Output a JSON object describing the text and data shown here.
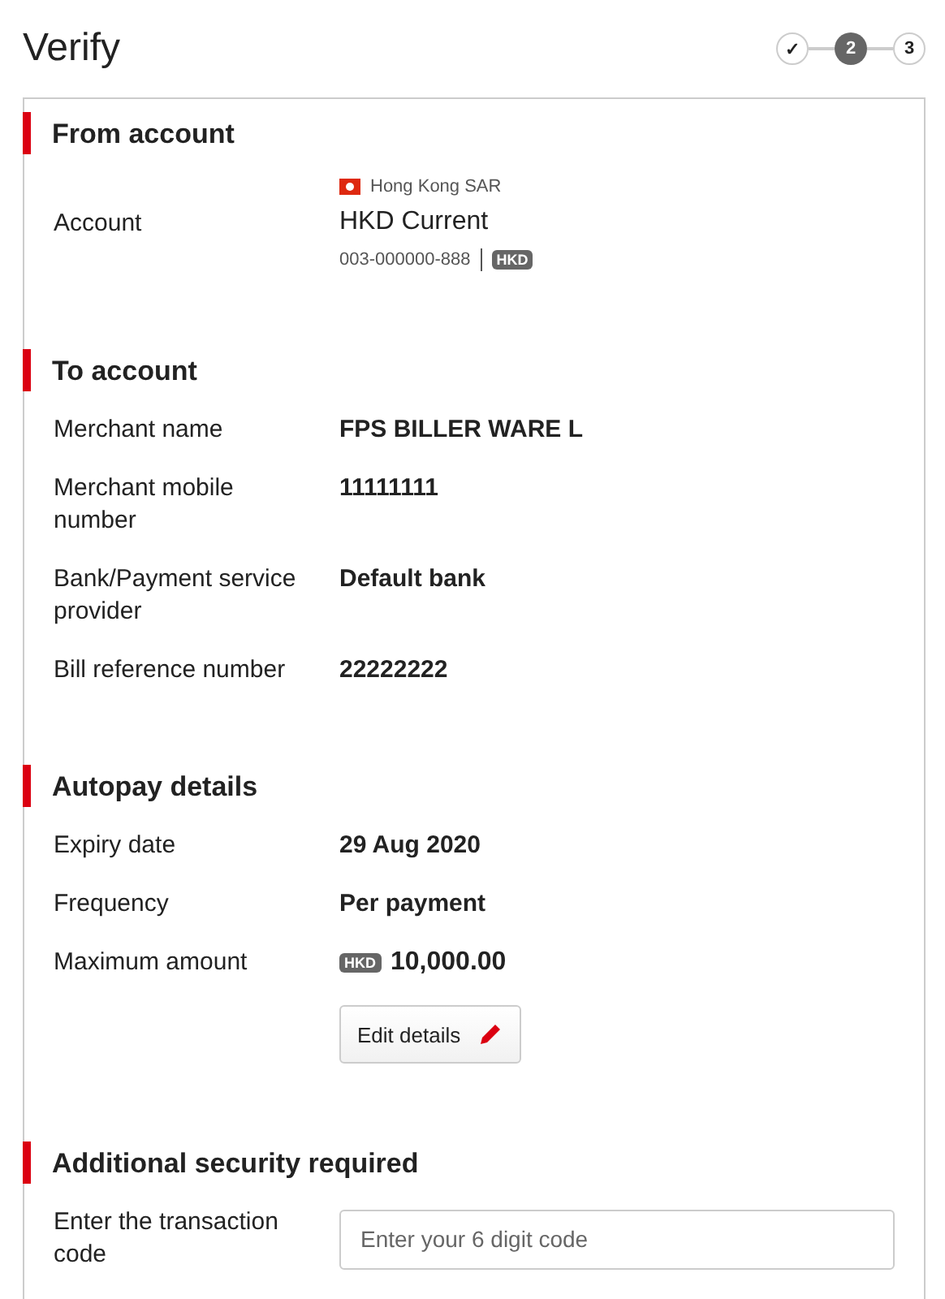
{
  "title": "Verify",
  "steps": [
    {
      "label": "✓",
      "selected": false
    },
    {
      "label": "2",
      "selected": true
    },
    {
      "label": "3",
      "selected": false
    }
  ],
  "sections": [
    {
      "title": "From account",
      "rows": [
        {
          "kind": "account",
          "label": "Account",
          "region": "Hong Kong SAR",
          "name": "HKD Current",
          "number": "003-000000-888",
          "currency": "HKD"
        }
      ]
    },
    {
      "title": "To account",
      "rows": [
        {
          "kind": "text",
          "label": "Merchant name",
          "value": "FPS BILLER WARE L"
        },
        {
          "kind": "text",
          "label": "Merchant mobile number",
          "value": "11111111"
        },
        {
          "kind": "text",
          "label": "Bank/Payment service provider",
          "value": "Default bank"
        },
        {
          "kind": "text",
          "label": "Bill reference number",
          "value": "22222222"
        }
      ]
    },
    {
      "title": "Autopay details",
      "rows": [
        {
          "kind": "text",
          "label": "Expiry date",
          "value": "29 Aug 2020"
        },
        {
          "kind": "text",
          "label": "Frequency",
          "value": "Per payment"
        },
        {
          "kind": "amount",
          "label": "Maximum amount",
          "currency": "HKD",
          "value": "10,000.00"
        },
        {
          "kind": "button",
          "label": "Edit details"
        }
      ]
    },
    {
      "title": "Additional security required",
      "rows": [
        {
          "kind": "field",
          "label": "Enter the transaction code",
          "placeholder": "Enter your 6 digit code"
        }
      ]
    }
  ]
}
